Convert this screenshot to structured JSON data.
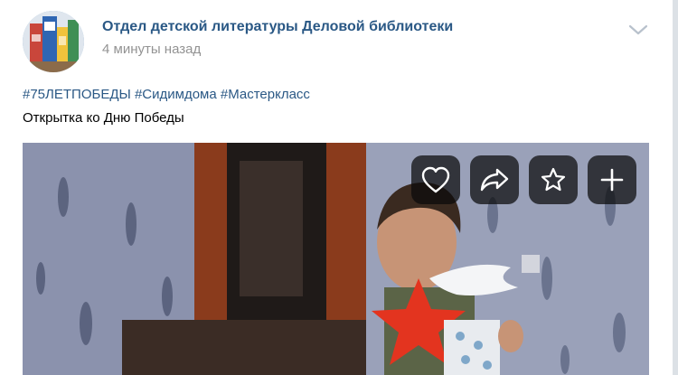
{
  "post": {
    "author": "Отдел детской литературы Деловой библиотеки",
    "time": "4 минуты назад",
    "hashtags": [
      "#75ЛЕТПОБЕДЫ",
      "#Сидимдома",
      "#Мастеркласс"
    ],
    "caption": "Открытка ко Дню Победы"
  },
  "video": {
    "actions": [
      "heart-icon",
      "share-icon",
      "star-icon",
      "plus-icon"
    ]
  },
  "colors": {
    "link": "#2a5885",
    "muted": "#939393",
    "overlay_button": "#0a0a0a"
  }
}
